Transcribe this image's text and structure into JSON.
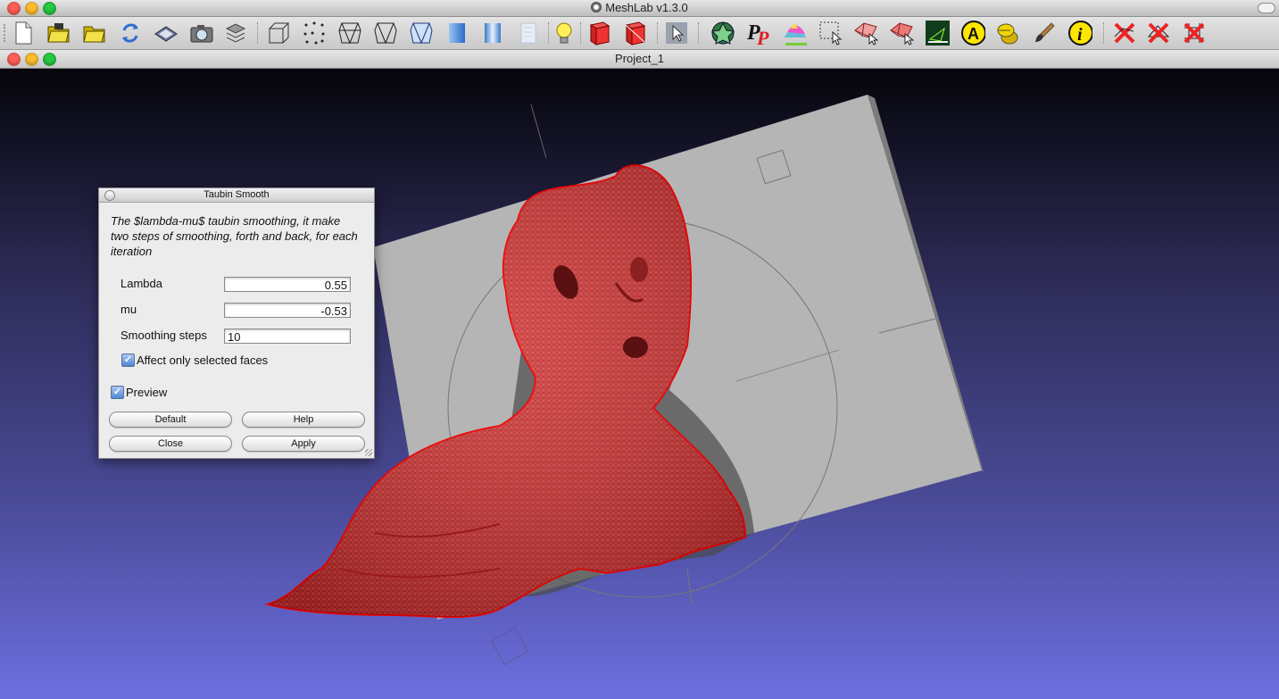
{
  "window": {
    "title": "MeshLab v1.3.0",
    "document_title": "Project_1"
  },
  "toolbar": {
    "icons": [
      "new-project-icon",
      "open-project-icon",
      "import-mesh-icon",
      "reload-icon",
      "save-icon",
      "snapshot-icon",
      "layers-icon",
      "bounding-box-icon",
      "points-icon",
      "wireframe-icon",
      "hidden-lines-icon",
      "flat-lines-icon",
      "flat-shading-icon",
      "smooth-shading-icon",
      "texture-icon",
      "light-icon",
      "backface-icon",
      "select-vertexes-icon",
      "manipulator-icon",
      "colorize-icon",
      "pickpoints-icon",
      "paint-icon",
      "select-region-icon",
      "select-faces-icon",
      "select-connected-icon",
      "align-icon",
      "measure-icon",
      "annotation-icon",
      "paintbrush-icon",
      "info-icon",
      "delete-vertices-icon",
      "delete-faces-icon",
      "delete-selected-icon"
    ]
  },
  "dialog": {
    "title": "Taubin Smooth",
    "description": "The $lambda-mu$ taubin smoothing, it make two steps of smoothing, forth and back, for each iteration",
    "fields": [
      {
        "label": "Lambda",
        "value": "0.55"
      },
      {
        "label": "mu",
        "value": "-0.53"
      },
      {
        "label": "Smoothing steps",
        "value": "10"
      }
    ],
    "affect_selected_label": "Affect only selected faces",
    "affect_selected_checked": true,
    "preview_label": "Preview",
    "preview_checked": true,
    "buttons": {
      "default": "Default",
      "help": "Help",
      "close": "Close",
      "apply": "Apply"
    }
  },
  "colors": {
    "mesh": "#e23333",
    "plane": "#b4b4b4",
    "bg_top": "#05050b",
    "bg_bottom": "#6d6fe0"
  }
}
